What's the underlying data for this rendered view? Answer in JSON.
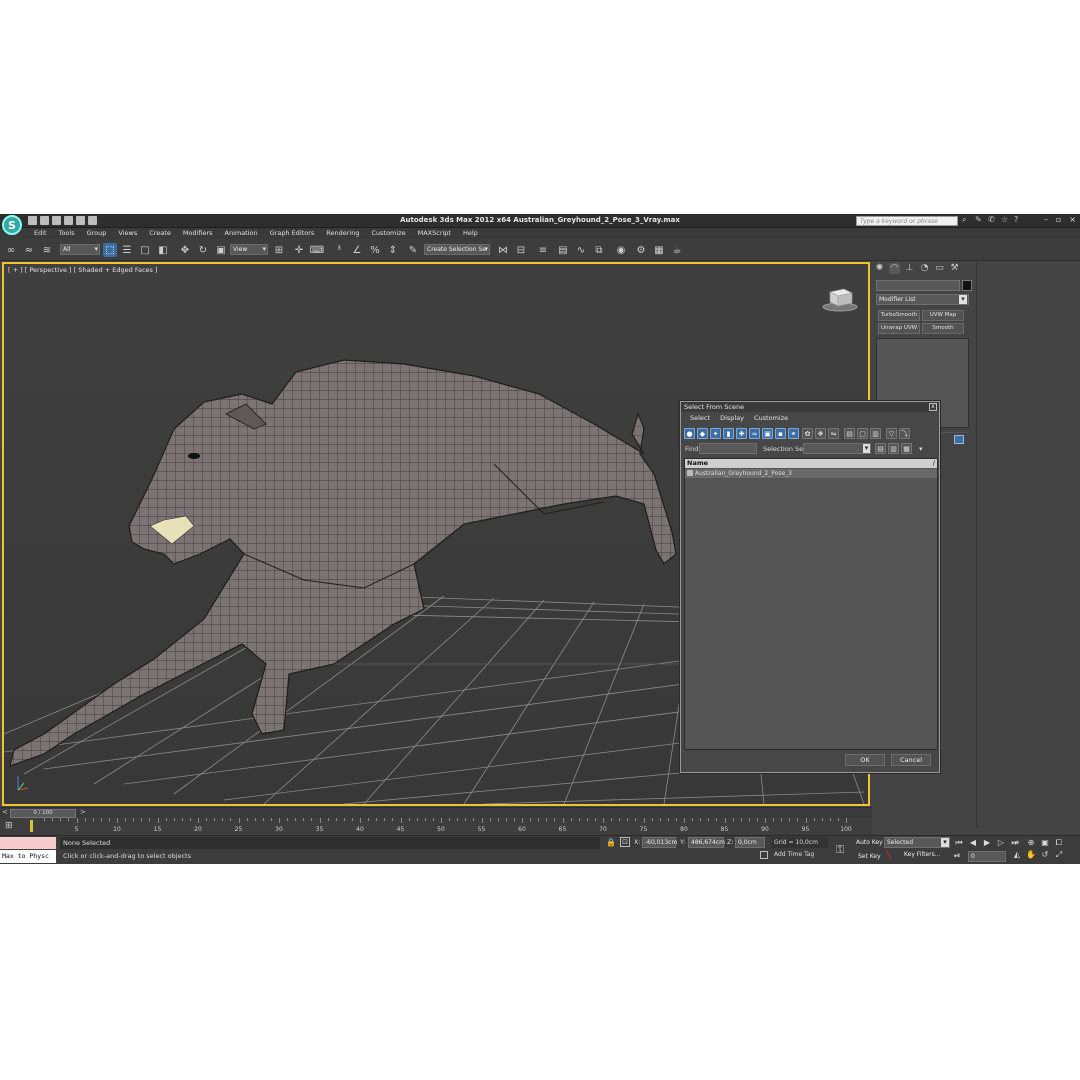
{
  "app": {
    "logo_glyph": "S",
    "title": "Autodesk 3ds Max  2012 x64      Australian_Greyhound_2_Pose_3_Vray.max",
    "help_search_placeholder": "Type a keyword or phrase"
  },
  "menu": [
    "Edit",
    "Tools",
    "Group",
    "Views",
    "Create",
    "Modifiers",
    "Animation",
    "Graph Editors",
    "Rendering",
    "Customize",
    "MAXScript",
    "Help"
  ],
  "toolbar": {
    "selection_filter": "All",
    "reference_coord": "View",
    "named_selection_set": "Create Selection Se"
  },
  "viewport": {
    "label": "[ + ] [ Perspective ] [ Shaded + Edged Faces ]",
    "axis_label": "z",
    "accent_color": "#f1c232"
  },
  "command_panel": {
    "modifier_list": "Modifier List",
    "buttons": [
      "TurboSmooth",
      "UVW Map",
      "Unwrap UVW",
      "Smooth"
    ]
  },
  "timeline": {
    "position": "0 / 100",
    "ticks": [
      5,
      10,
      15,
      20,
      25,
      30,
      35,
      40,
      45,
      50,
      55,
      60,
      65,
      70,
      75,
      80,
      85,
      90,
      95,
      100
    ]
  },
  "status": {
    "maxscript": "Max to Physc",
    "selection": "None Selected",
    "prompt": "Click or click-and-drag to select objects",
    "x_label": "X:",
    "x_value": "-60,013cm",
    "y_label": "Y:",
    "y_value": "486,674cm",
    "z_label": "Z:",
    "z_value": "0,0cm",
    "grid": "Grid = 10,0cm",
    "add_time_tag": "Add Time Tag",
    "auto_key": "Auto Key",
    "set_key": "Set Key",
    "key_mode": "Selected",
    "key_filters": "Key Filters...",
    "frame": "0"
  },
  "dialog": {
    "title": "Select From Scene",
    "close_glyph": "x",
    "menu": [
      "Select",
      "Display",
      "Customize"
    ],
    "find_label": "Find:",
    "selection_set_label": "Selection Set:",
    "column_header": "Name",
    "sort_indicator": "/",
    "items": [
      "Australian_Greyhound_2_Pose_3"
    ],
    "ok": "OK",
    "cancel": "Cancel"
  }
}
